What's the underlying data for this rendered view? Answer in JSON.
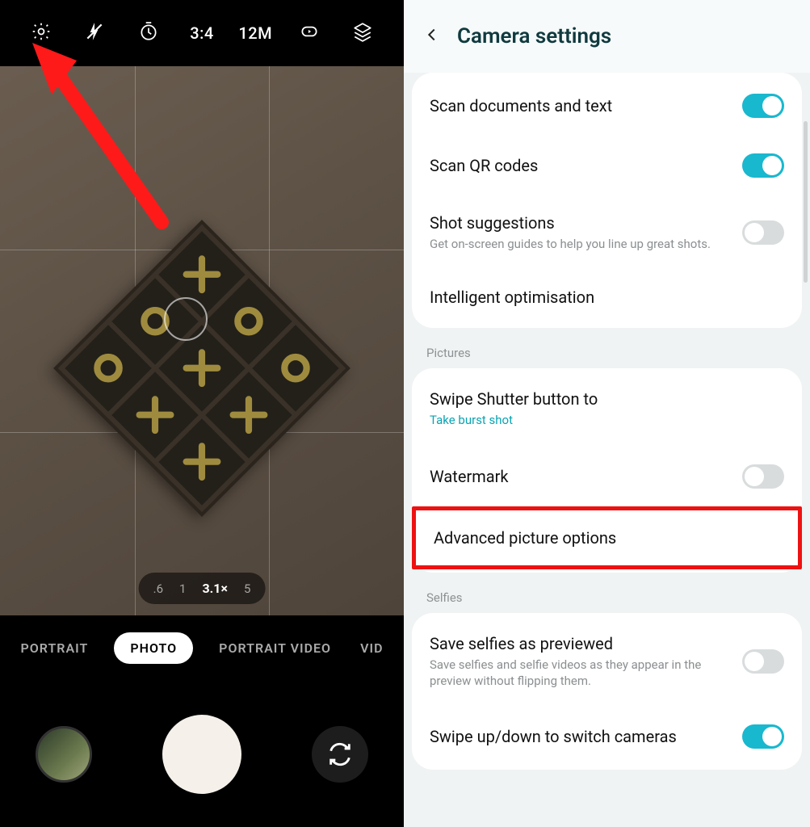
{
  "camera": {
    "topbar": {
      "aspect": "3:4",
      "mp": "12M"
    },
    "zoom": [
      "​.6",
      "1",
      "3.1×",
      "5"
    ],
    "modes": [
      "PORTRAIT",
      "PHOTO",
      "PORTRAIT VIDEO",
      "VID"
    ]
  },
  "settings": {
    "title": "Camera settings",
    "group1": [
      {
        "title": "Scan documents and text",
        "sub": "",
        "toggle": "on"
      },
      {
        "title": "Scan QR codes",
        "sub": "",
        "toggle": "on"
      },
      {
        "title": "Shot suggestions",
        "sub": "Get on-screen guides to help you line up great shots.",
        "toggle": "off"
      },
      {
        "title": "Intelligent optimisation",
        "sub": "",
        "toggle": "none"
      }
    ],
    "section_pictures": "Pictures",
    "group2": [
      {
        "title": "Swipe Shutter button to",
        "sub": "Take burst shot",
        "sublink": true,
        "toggle": "none"
      },
      {
        "title": "Watermark",
        "sub": "",
        "toggle": "off"
      },
      {
        "title": "Advanced picture options",
        "sub": "",
        "toggle": "none",
        "highlight": true
      }
    ],
    "section_selfies": "Selfies",
    "group3": [
      {
        "title": "Save selfies as previewed",
        "sub": "Save selfies and selfie videos as they appear in the preview without flipping them.",
        "toggle": "off"
      },
      {
        "title": "Swipe up/down to switch cameras",
        "sub": "",
        "toggle": "on"
      }
    ]
  }
}
